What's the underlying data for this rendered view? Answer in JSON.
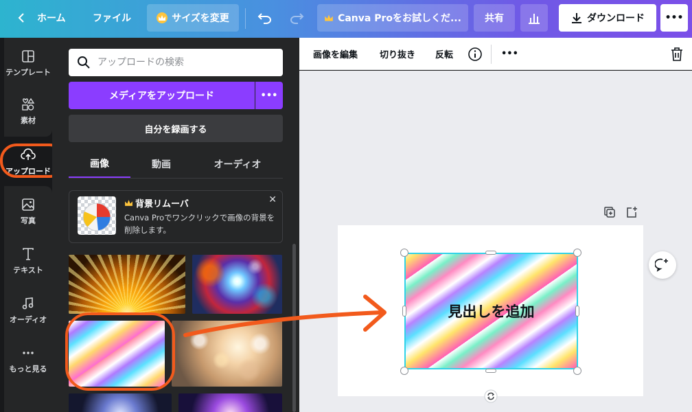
{
  "topbar": {
    "home_label": "ホーム",
    "file_label": "ファイル",
    "resize_label": "サイズを変更",
    "pro_label": "Canva Proをお試しくだ...",
    "share_label": "共有",
    "download_label": "ダウンロード",
    "more_label": "•••",
    "gradient_start": "#2db4cf",
    "gradient_end": "#7b4fe8"
  },
  "rail": {
    "items": [
      {
        "label": "テンプレート",
        "icon": "template-icon"
      },
      {
        "label": "素材",
        "icon": "elements-icon"
      },
      {
        "label": "アップロード",
        "icon": "upload-cloud-icon"
      },
      {
        "label": "写真",
        "icon": "photo-icon"
      },
      {
        "label": "テキスト",
        "icon": "text-icon"
      },
      {
        "label": "オーディオ",
        "icon": "music-icon"
      },
      {
        "label": "もっと見る",
        "icon": "more-dots-icon"
      }
    ],
    "active": "アップロード"
  },
  "panel": {
    "search_placeholder": "アップロードの検索",
    "upload_button": "メディアをアップロード",
    "upload_more": "•••",
    "record_button": "自分を録画する",
    "tabs": [
      "画像",
      "動画",
      "オーディオ"
    ],
    "active_tab": "画像",
    "promo": {
      "title": "背景リムーバ",
      "description": "Canva Proでワンクリックで画像の背景を削除します。",
      "close": "✕"
    },
    "accent_color": "#8b3dff"
  },
  "context_toolbar": {
    "edit_image": "画像を編集",
    "crop": "切り抜き",
    "flip": "反転",
    "more": "•••"
  },
  "canvas": {
    "heading_text": "見出しを追加",
    "selection_color": "#2fd2e8"
  },
  "annotation_color": "#f25a1c"
}
